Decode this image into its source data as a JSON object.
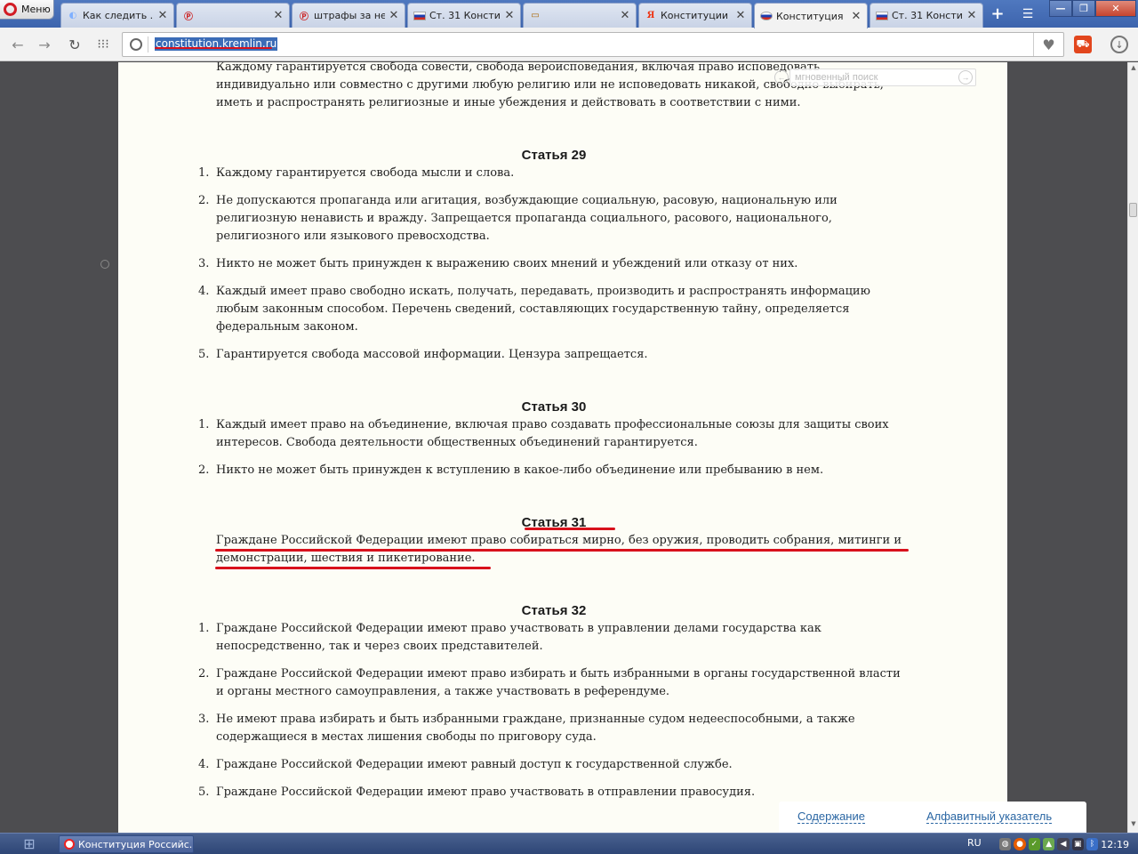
{
  "browser": {
    "menu_label": "Меню",
    "tabs": [
      {
        "title": "Как следить ..."
      },
      {
        "title": ""
      },
      {
        "title": "штрафы за нес..."
      },
      {
        "title": "Ст. 31 Констит..."
      },
      {
        "title": ""
      },
      {
        "title": "Конституции Р..."
      },
      {
        "title": "Конституция Р..."
      },
      {
        "title": "Ст. 31 Констит..."
      }
    ],
    "address": "constitution.kremlin.ru",
    "instant_search_placeholder": "мгновенный поиск",
    "accent_color": "#d21c24"
  },
  "page": {
    "intro_lines": "Каждому гарантируется свобода совести, свобода вероисповедания, включая право исповедовать индивидуально или совместно с другими любую религию или не исповедовать никакой, свободно выбирать, иметь и распространять религиозные и иные убеждения и действовать в соответствии с ними.",
    "articles": [
      {
        "heading": "Статья 29",
        "items": [
          {
            "num": "1.",
            "text": "Каждому гарантируется свобода мысли и слова."
          },
          {
            "num": "2.",
            "text": "Не допускаются пропаганда или агитация, возбуждающие социальную, расовую, национальную или религиозную ненависть и вражду. Запрещается пропаганда социального, расового, национального, религиозного или языкового превосходства."
          },
          {
            "num": "3.",
            "text": "Никто не может быть принужден к выражению своих мнений и убеждений или отказу от них."
          },
          {
            "num": "4.",
            "text": "Каждый имеет право свободно искать, получать, передавать, производить и распространять информацию любым законным способом. Перечень сведений, составляющих государственную тайну, определяется федеральным законом."
          },
          {
            "num": "5.",
            "text": "Гарантируется свобода массовой информации. Цензура запрещается."
          }
        ]
      },
      {
        "heading": "Статья 30",
        "items": [
          {
            "num": "1.",
            "text": "Каждый имеет право на объединение, включая право создавать профессиональные союзы для защиты своих интересов. Свобода деятельности общественных объединений гарантируется."
          },
          {
            "num": "2.",
            "text": "Никто не может быть принужден к вступлению в какое-либо объединение или пребыванию в нем."
          }
        ]
      },
      {
        "heading": "Статья 31",
        "text": "Граждане Российской Федерации имеют право собираться мирно, без оружия, проводить собрания, митинги и демонстрации, шествия и пикетирование."
      },
      {
        "heading": "Статья 32",
        "items": [
          {
            "num": "1.",
            "text": "Граждане Российской Федерации имеют право участвовать в управлении делами государства как непосредственно, так и через своих представителей."
          },
          {
            "num": "2.",
            "text": "Граждане Российской Федерации имеют право избирать и быть избранными в органы государственной власти и органы местного самоуправления, а также участвовать в референдуме."
          },
          {
            "num": "3.",
            "text": "Не имеют права избирать и быть избранными граждане, признанные судом недееспособными, а также содержащиеся в местах лишения свободы по приговору суда."
          },
          {
            "num": "4.",
            "text": "Граждане Российской Федерации имеют равный доступ к государственной службе."
          },
          {
            "num": "5.",
            "text": "Граждане Российской Федерации имеют право участвовать в отправлении правосудия."
          }
        ]
      }
    ],
    "bottom_links": {
      "contents": "Содержание",
      "index": "Алфавитный указатель"
    }
  },
  "taskbar": {
    "task_title": "Конституция Российс...",
    "lang": "RU",
    "clock": "12:19"
  }
}
